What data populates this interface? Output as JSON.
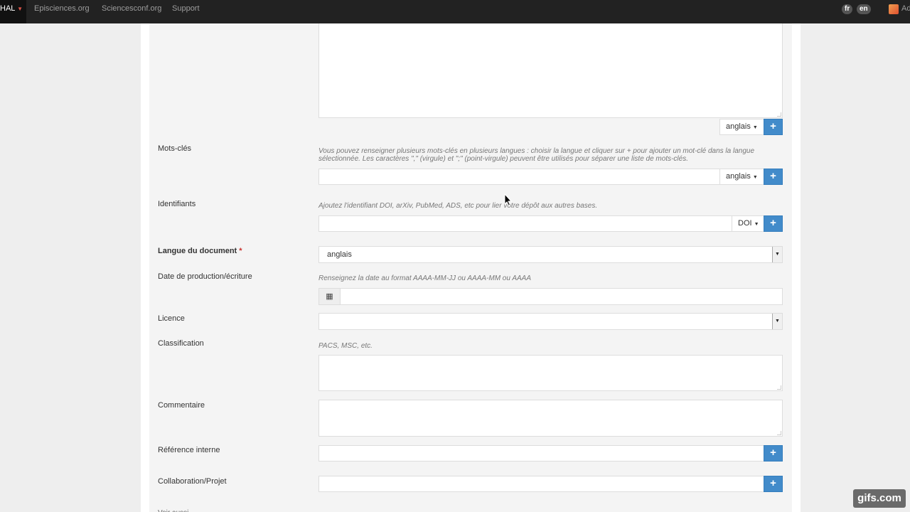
{
  "topbar": {
    "brand": "HAL",
    "nav": [
      "Episciences.org",
      "Sciencesconf.org",
      "Support"
    ],
    "lang_fr": "fr",
    "lang_en": "en",
    "account": "Ad"
  },
  "form": {
    "abstract_lang": "anglais",
    "keywords": {
      "label": "Mots-clés",
      "help": "Vous pouvez renseigner plusieurs mots-clés en plusieurs langues : choisir la langue et cliquer sur + pour ajouter un mot-clé dans la langue sélectionnée. Les caractères \",\" (virgule) et \";\" (point-virgule) peuvent être utilisés pour séparer une liste de mots-clés.",
      "lang": "anglais"
    },
    "identifiers": {
      "label": "Identifiants",
      "help": "Ajoutez l'identifiant DOI, arXiv, PubMed, ADS, etc pour lier votre dépôt aux autres bases.",
      "type": "DOI"
    },
    "doc_lang": {
      "label": "Langue du document",
      "required_mark": "*",
      "value": "anglais"
    },
    "date": {
      "label": "Date de production/écriture",
      "help": "Renseignez la date au format AAAA-MM-JJ ou AAAA-MM ou AAAA"
    },
    "licence": {
      "label": "Licence"
    },
    "classification": {
      "label": "Classification",
      "help": "PACS, MSC, etc."
    },
    "comment": {
      "label": "Commentaire"
    },
    "internal_ref": {
      "label": "Référence interne"
    },
    "collab": {
      "label": "Collaboration/Projet"
    },
    "next_label": "Voir aussi"
  },
  "icons": {
    "plus": "+",
    "caret": "▼",
    "calendar": "▦"
  },
  "watermark": "gifs.com",
  "colors": {
    "primary": "#428bca",
    "navbar": "#222222",
    "required": "#c9302c"
  }
}
